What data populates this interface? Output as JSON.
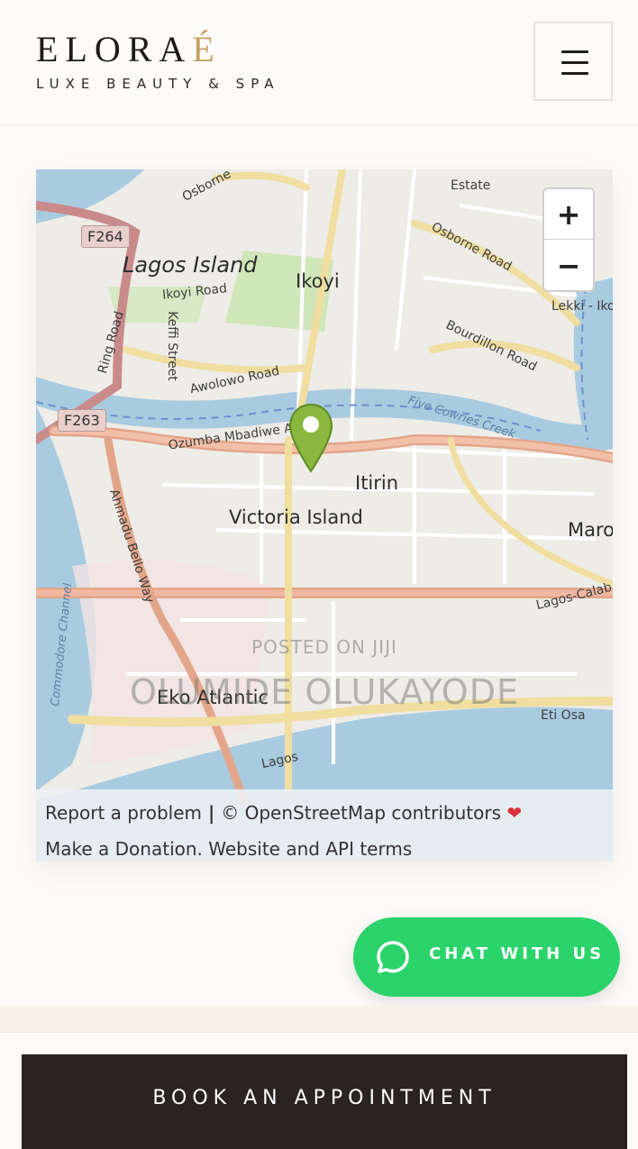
{
  "header": {
    "brand_main": "ELORA",
    "brand_accent": "É",
    "tagline": "LUXE BEAUTY & SPA",
    "menu_icon": "hamburger-menu-icon"
  },
  "map": {
    "labels": {
      "lagos_island": "Lagos Island",
      "ikoyi": "Ikoyi",
      "victoria_island": "Victoria Island",
      "itirin": "Itirin",
      "eko_atlantic": "Eko Atlantic",
      "estate": "Estate",
      "maroko": "Maro",
      "eti_osa": "Eti Osa",
      "lagos_coast": "Lagos",
      "ikoyi_road": "Ikoyi Road",
      "keffi_street": "Keffi Street",
      "awolowo_road": "Awolowo Road",
      "osborne_road": "Osborne Road",
      "osborne_top": "Osborne",
      "bourdillon_road": "Bourdillon Road",
      "ozumba": "Ozumba Mbadiwe Avenue",
      "ahmadu_bello": "Ahmadu Bello Way",
      "ring_road": "Ring Road",
      "five_cowries": "Five Cowries Creek",
      "lekki": "Lekki - Iko",
      "lagos_calabar": "Lagos-Calab",
      "channel": "Commodore Channel",
      "f264": "F264",
      "f263": "F263"
    },
    "zoom_in": "+",
    "zoom_out": "−",
    "watermark_line1": "POSTED ON JIJI",
    "watermark_line2": "OLUMIDE OLUKAYODE",
    "attribution": {
      "report": "Report a problem",
      "separator": " | ",
      "osm": "© OpenStreetMap contributors",
      "heart": "❤",
      "donate": "Make a Donation.",
      "terms": " Website and API terms"
    },
    "pin_color": "#8ab83e"
  },
  "chat": {
    "label": "CHAT WITH US",
    "icon": "whatsapp-chat-icon",
    "color": "#2bd46a"
  },
  "cta": {
    "book_label": "BOOK AN APPOINTMENT"
  },
  "colors": {
    "accent_gold": "#c2a165",
    "dark": "#2a2420",
    "water": "#a9cbe0"
  }
}
